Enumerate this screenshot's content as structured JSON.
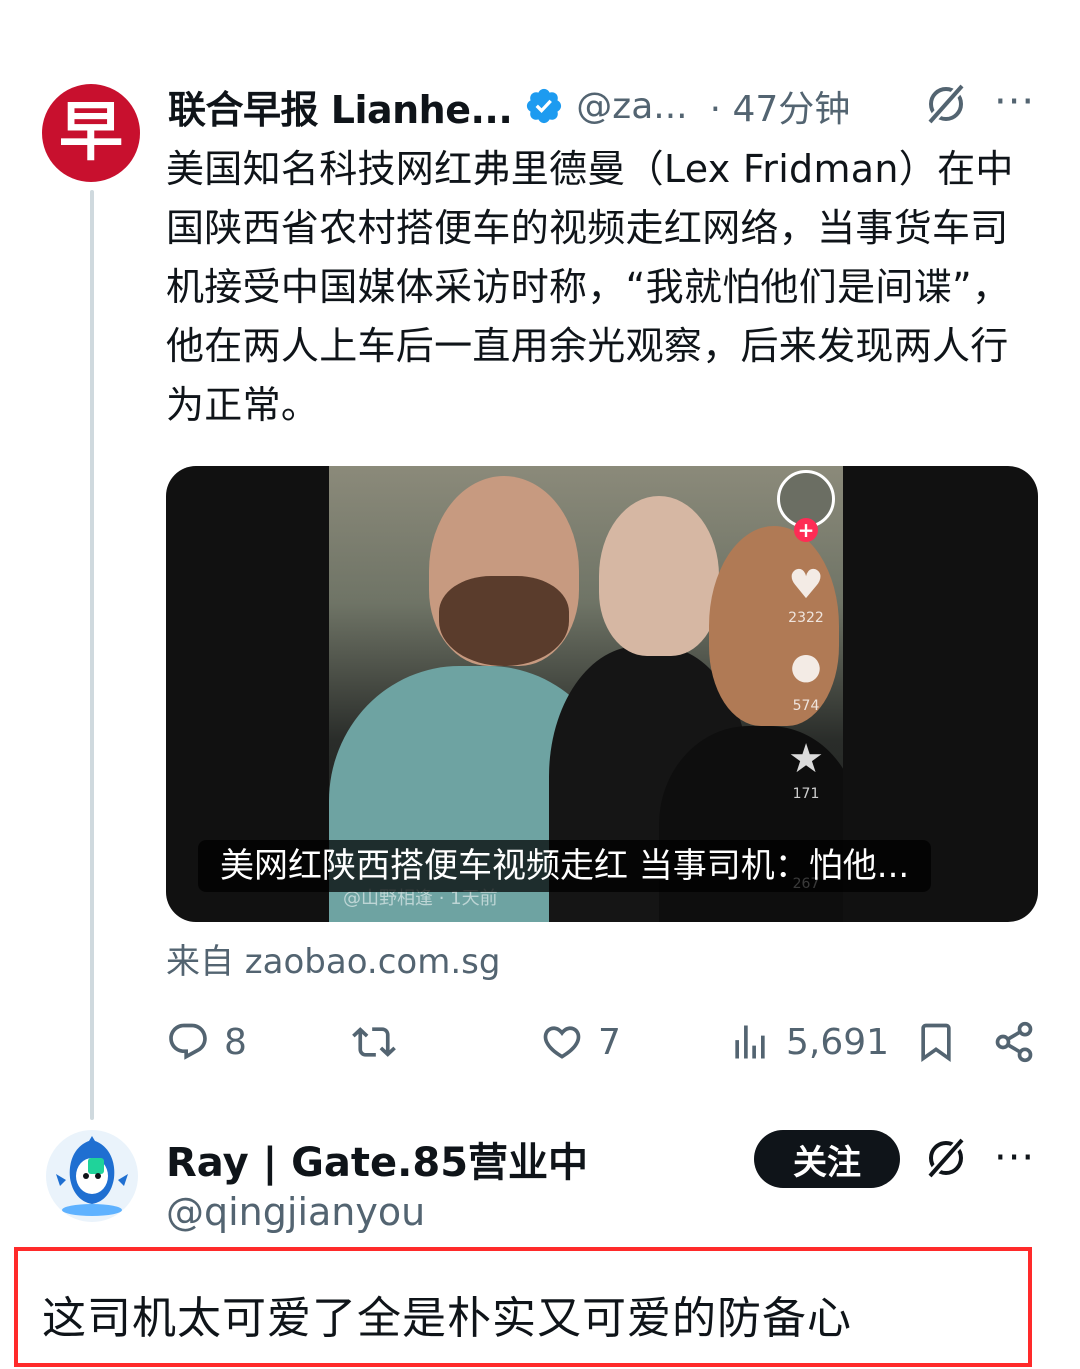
{
  "tweet": {
    "avatar_char": "早",
    "display_name": "联合早报 Lianhe...",
    "handle": "@za...",
    "time": "· 47分钟",
    "text": "美国知名科技网红弗里德曼（Lex Fridman）在中国陕西省农村搭便车的视频走红网络，当事货车司机接受中国媒体采访时称，“我就怕他们是间谍”，他在两人上车后一直用余光观察，后来发现两人行为正常。",
    "media": {
      "caption": "美网红陕西搭便车视频走红 当事司机：怕他...",
      "watermark": "@山野相逢 · 1天前",
      "like_count": "2322",
      "comment_count": "574",
      "star_count": "171",
      "share_count": "267"
    },
    "source": "来自 zaobao.com.sg",
    "actions": {
      "replies": "8",
      "retweets": "",
      "likes": "7",
      "views": "5,691"
    },
    "more_label": "···"
  },
  "reply": {
    "display_name": "Ray | Gate.85营业中",
    "handle": "@qingjianyou",
    "follow_label": "关注",
    "more_label": "···",
    "text": "这司机太可爱了全是朴实又可爱的防备心"
  },
  "colors": {
    "accent_red": "#c8102e",
    "secondary_text": "#536471",
    "verified_blue": "#1d9bf0",
    "highlight_border": "#ff2a2a"
  },
  "icons": [
    "verified-badge-icon",
    "grok-icon",
    "more-icon",
    "reply-icon",
    "retweet-icon",
    "like-icon",
    "views-icon",
    "bookmark-icon",
    "share-icon"
  ]
}
